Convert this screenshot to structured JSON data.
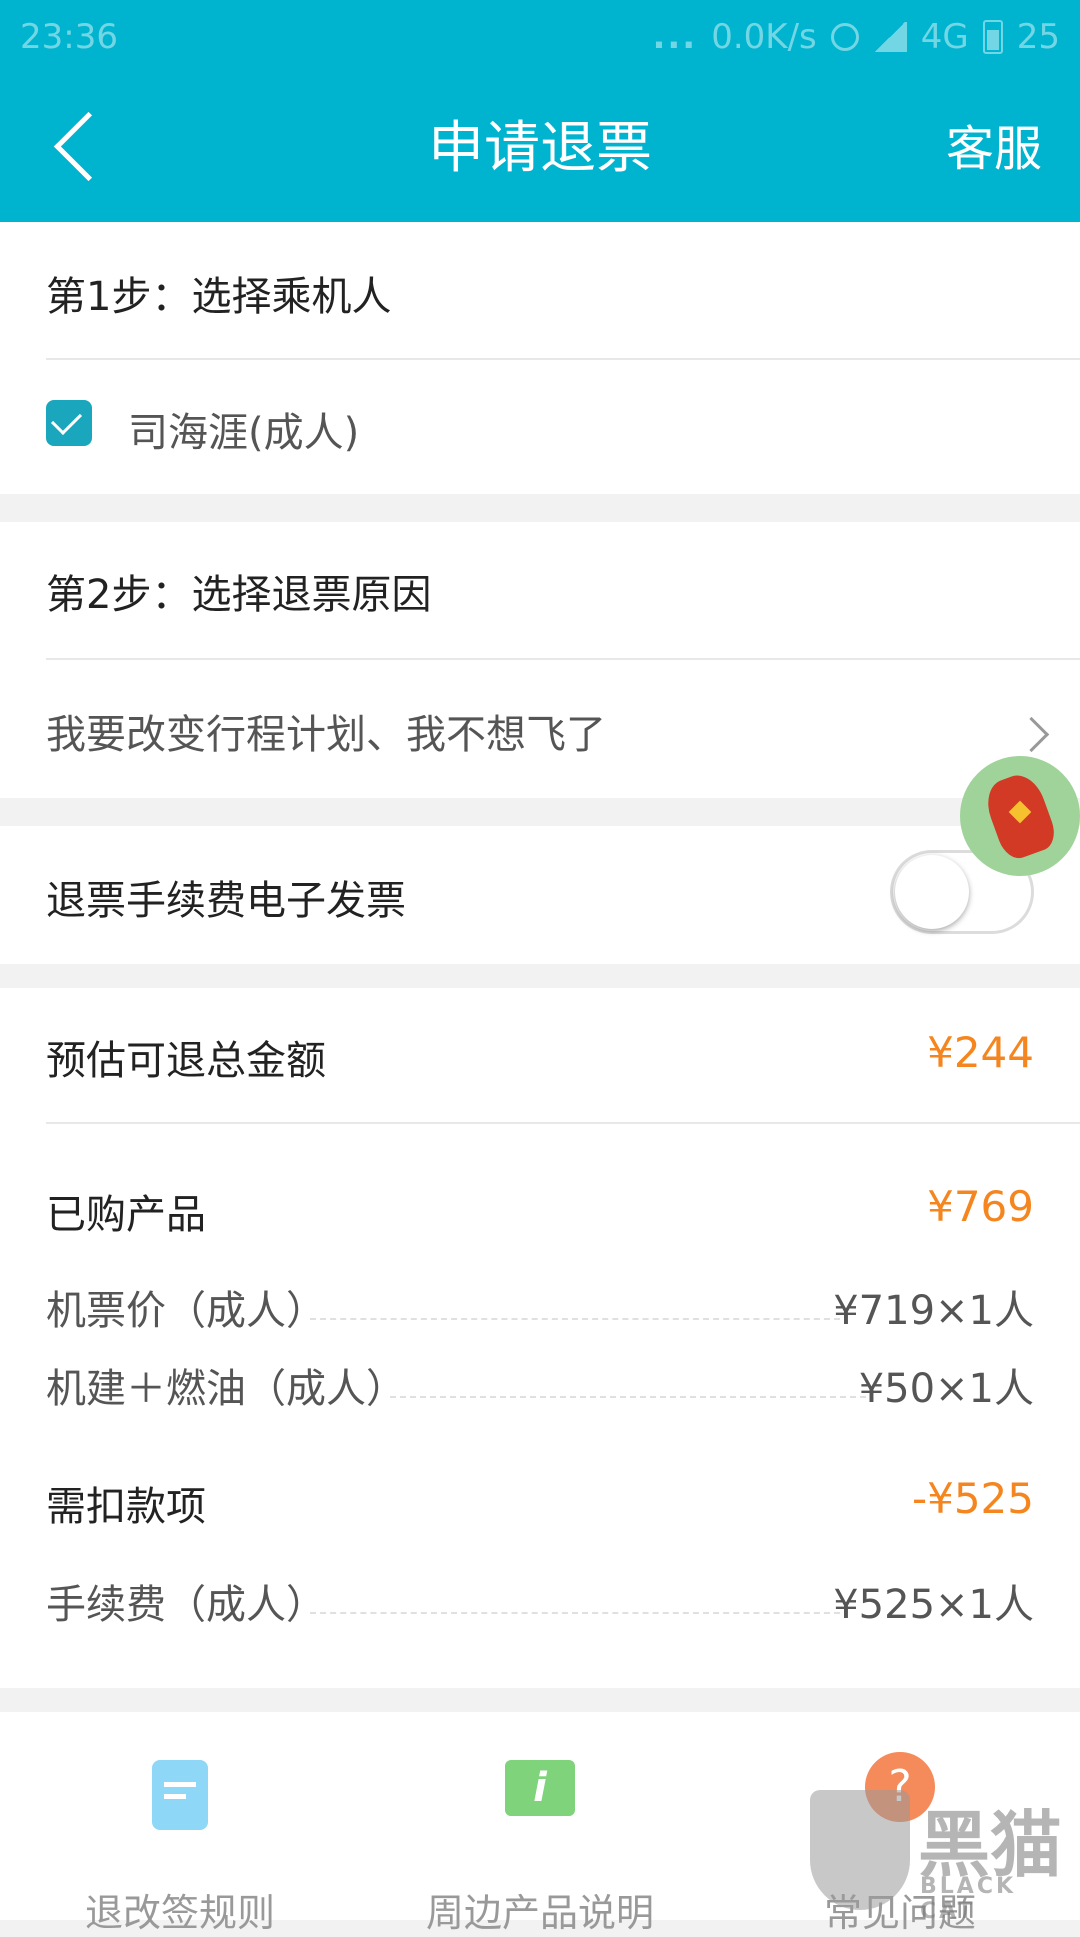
{
  "status_bar": {
    "time": "23:36",
    "dots": "...",
    "speed": "0.0K/s",
    "network": "4G",
    "battery": "25"
  },
  "header": {
    "title": "申请退票",
    "service_label": "客服"
  },
  "step1": {
    "title": "第1步：选择乘机人",
    "passenger": "司海涯(成人)",
    "checked": true
  },
  "step2": {
    "title": "第2步：选择退票原因",
    "reason": "我要改变行程计划、我不想飞了"
  },
  "invoice": {
    "label": "退票手续费电子发票",
    "enabled": false
  },
  "refund": {
    "estimated_label": "预估可退总金额",
    "estimated_value": "¥244",
    "purchased_label": "已购产品",
    "purchased_value": "¥769",
    "purchased_lines": [
      {
        "label": "机票价（成人）",
        "value": "¥719×1人"
      },
      {
        "label": "机建＋燃油（成人）",
        "value": "¥50×1人"
      }
    ],
    "deduct_label": "需扣款项",
    "deduct_value": "-¥525",
    "deduct_lines": [
      {
        "label": "手续费（成人）",
        "value": "¥525×1人"
      }
    ]
  },
  "bottom_tabs": [
    {
      "label": "退改签规则",
      "icon": "document-icon"
    },
    {
      "label": "周边产品说明",
      "icon": "info-ticket-icon"
    },
    {
      "label": "常见问题",
      "icon": "question-icon"
    }
  ],
  "watermark": {
    "text": "黑猫",
    "sub": "BLACK CAT"
  },
  "colors": {
    "primary": "#00b4cf",
    "accent_orange": "#f5861f",
    "checkbox": "#1aa6bd"
  }
}
